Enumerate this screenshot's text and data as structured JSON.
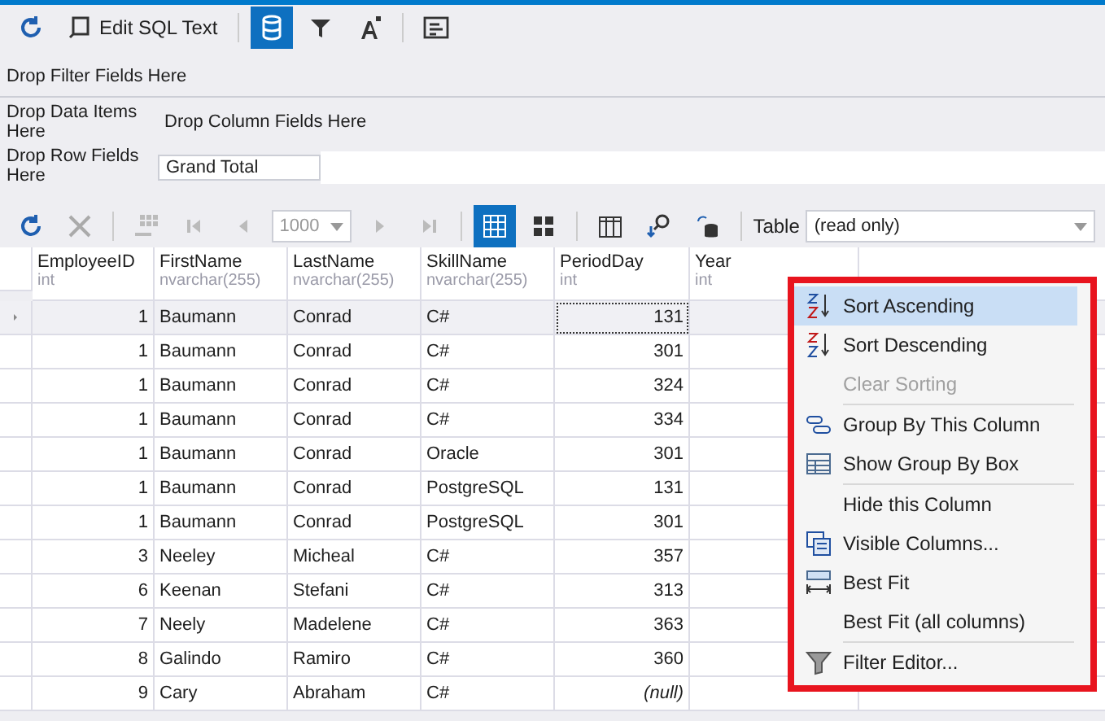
{
  "toolbar": {
    "edit_sql": "Edit SQL Text",
    "data_view_selected": true
  },
  "pivot": {
    "filter_hint": "Drop Filter Fields Here",
    "data_hint": "Drop Data Items Here",
    "column_hint": "Drop Column Fields Here",
    "row_hint": "Drop Row Fields Here",
    "grand_total": "Grand Total"
  },
  "grid_toolbar": {
    "page_size": "1000",
    "table_label": "Table",
    "table_value": "(read only)",
    "grid_view_selected": true
  },
  "table": {
    "columns": [
      {
        "name": "EmployeeID",
        "type": "int"
      },
      {
        "name": "FirstName",
        "type": "nvarchar(255)"
      },
      {
        "name": "LastName",
        "type": "nvarchar(255)"
      },
      {
        "name": "SkillName",
        "type": "nvarchar(255)"
      },
      {
        "name": "PeriodDay",
        "type": "int"
      },
      {
        "name": "Year",
        "type": "int"
      }
    ],
    "rows": [
      {
        "selected": true,
        "cells": [
          "1",
          "Baumann",
          "Conrad",
          "C#",
          "131",
          ""
        ]
      },
      {
        "selected": false,
        "cells": [
          "1",
          "Baumann",
          "Conrad",
          "C#",
          "301",
          ""
        ]
      },
      {
        "selected": false,
        "cells": [
          "1",
          "Baumann",
          "Conrad",
          "C#",
          "324",
          ""
        ]
      },
      {
        "selected": false,
        "cells": [
          "1",
          "Baumann",
          "Conrad",
          "C#",
          "334",
          ""
        ]
      },
      {
        "selected": false,
        "cells": [
          "1",
          "Baumann",
          "Conrad",
          "Oracle",
          "301",
          ""
        ]
      },
      {
        "selected": false,
        "cells": [
          "1",
          "Baumann",
          "Conrad",
          "PostgreSQL",
          "131",
          ""
        ]
      },
      {
        "selected": false,
        "cells": [
          "1",
          "Baumann",
          "Conrad",
          "PostgreSQL",
          "301",
          ""
        ]
      },
      {
        "selected": false,
        "cells": [
          "3",
          "Neeley",
          "Micheal",
          "C#",
          "357",
          ""
        ]
      },
      {
        "selected": false,
        "cells": [
          "6",
          "Keenan",
          "Stefani",
          "C#",
          "313",
          ""
        ]
      },
      {
        "selected": false,
        "cells": [
          "7",
          "Neely",
          "Madelene",
          "C#",
          "363",
          ""
        ]
      },
      {
        "selected": false,
        "cells": [
          "8",
          "Galindo",
          "Ramiro",
          "C#",
          "360",
          ""
        ]
      },
      {
        "selected": false,
        "cells": [
          "9",
          "Cary",
          "Abraham",
          "C#",
          "(null)",
          ""
        ]
      }
    ]
  },
  "context_menu": {
    "items": [
      {
        "label": "Sort Ascending",
        "kind": "sort-asc",
        "selected": true,
        "disabled": false,
        "separator_before": false
      },
      {
        "label": "Sort Descending",
        "kind": "sort-desc",
        "selected": false,
        "disabled": false,
        "separator_before": false
      },
      {
        "label": "Clear Sorting",
        "kind": "plain",
        "selected": false,
        "disabled": true,
        "separator_before": false
      },
      {
        "label": "Group By This Column",
        "kind": "group",
        "selected": false,
        "disabled": false,
        "separator_before": true
      },
      {
        "label": "Show Group By Box",
        "kind": "group-box",
        "selected": false,
        "disabled": false,
        "separator_before": false
      },
      {
        "label": "Hide this Column",
        "kind": "plain",
        "selected": false,
        "disabled": false,
        "separator_before": true
      },
      {
        "label": "Visible Columns...",
        "kind": "columns",
        "selected": false,
        "disabled": false,
        "separator_before": false
      },
      {
        "label": "Best Fit",
        "kind": "best-fit",
        "selected": false,
        "disabled": false,
        "separator_before": false
      },
      {
        "label": "Best Fit (all columns)",
        "kind": "plain",
        "selected": false,
        "disabled": false,
        "separator_before": false
      },
      {
        "label": "Filter Editor...",
        "kind": "filter",
        "selected": false,
        "disabled": false,
        "separator_before": true
      }
    ]
  }
}
